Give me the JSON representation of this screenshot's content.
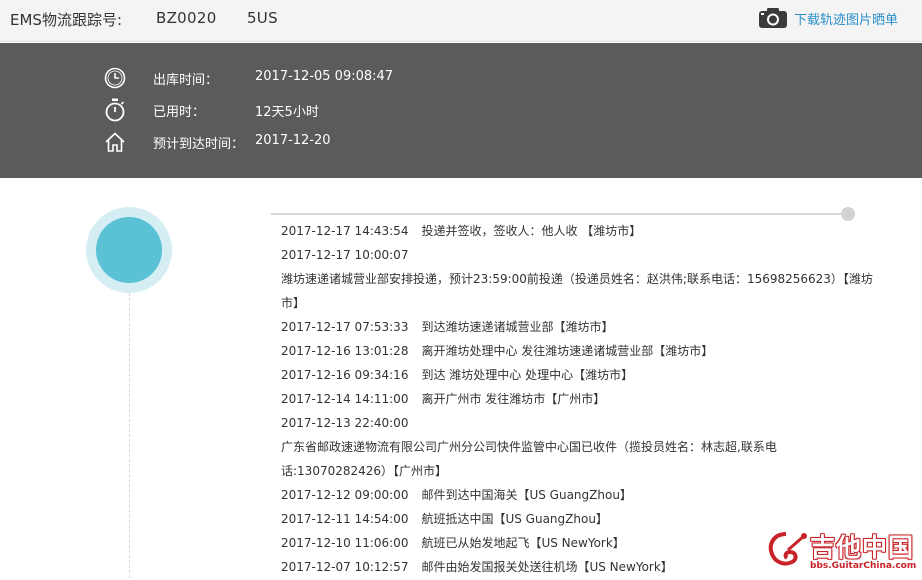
{
  "header": {
    "tracking_label": "EMS物流跟踪号:",
    "tracking_number": "BZ0020      5US",
    "download_label": "下载轨迹图片晒单",
    "download_icon": "camera-icon"
  },
  "info": {
    "rows": [
      {
        "icon": "clock-icon",
        "label": "出库时间：",
        "value": "2017-12-05 09:08:47"
      },
      {
        "icon": "stopwatch-icon",
        "label": "已用时：",
        "value": "12天5小时"
      },
      {
        "icon": "home-icon",
        "label": "预计到达时间：",
        "value": "2017-12-20"
      }
    ]
  },
  "timeline": {
    "events": [
      {
        "time": "2017-12-17 14:43:54",
        "desc": "投递并签收，签收人：他人收 【潍坊市】"
      },
      {
        "time": "2017-12-17 10:00:07",
        "desc": ""
      },
      {
        "time": "",
        "desc": "潍坊速递诸城营业部安排投递，预计23:59:00前投递（投递员姓名：赵洪伟;联系电话：15698256623）【潍坊市】"
      },
      {
        "time": "2017-12-17 07:53:33",
        "desc": "到达潍坊速递诸城营业部【潍坊市】"
      },
      {
        "time": "2017-12-16 13:01:28",
        "desc": "离开潍坊处理中心 发往潍坊速递诸城营业部【潍坊市】"
      },
      {
        "time": "2017-12-16 09:34:16",
        "desc": "到达 潍坊处理中心 处理中心【潍坊市】"
      },
      {
        "time": "2017-12-14 14:11:00",
        "desc": "离开广州市 发往潍坊市【广州市】"
      },
      {
        "time": "2017-12-13 22:40:00",
        "desc": ""
      },
      {
        "time": "",
        "desc": "广东省邮政速递物流有限公司广州分公司快件监管中心国已收件（揽投员姓名：林志超,联系电话:13070282426）【广州市】"
      },
      {
        "time": "2017-12-12 09:00:00",
        "desc": "邮件到达中国海关【US GuangZhou】"
      },
      {
        "time": "2017-12-11 14:54:00",
        "desc": "航班抵达中国【US GuangZhou】"
      },
      {
        "time": "2017-12-10 11:06:00",
        "desc": "航班已从始发地起飞【US NewYork】"
      },
      {
        "time": "2017-12-07 10:12:57",
        "desc": "邮件由始发国报关处送往机场【US NewYork】"
      }
    ]
  },
  "watermark": {
    "title": "吉他中国",
    "url": "bbs.GuitarChina.com"
  },
  "colors": {
    "accent": "#2a8fc9",
    "panel": "#5b5b5b",
    "marker": "#5bc2d6",
    "marker_ring": "#d4eef4",
    "watermark_red": "#c9232a"
  }
}
